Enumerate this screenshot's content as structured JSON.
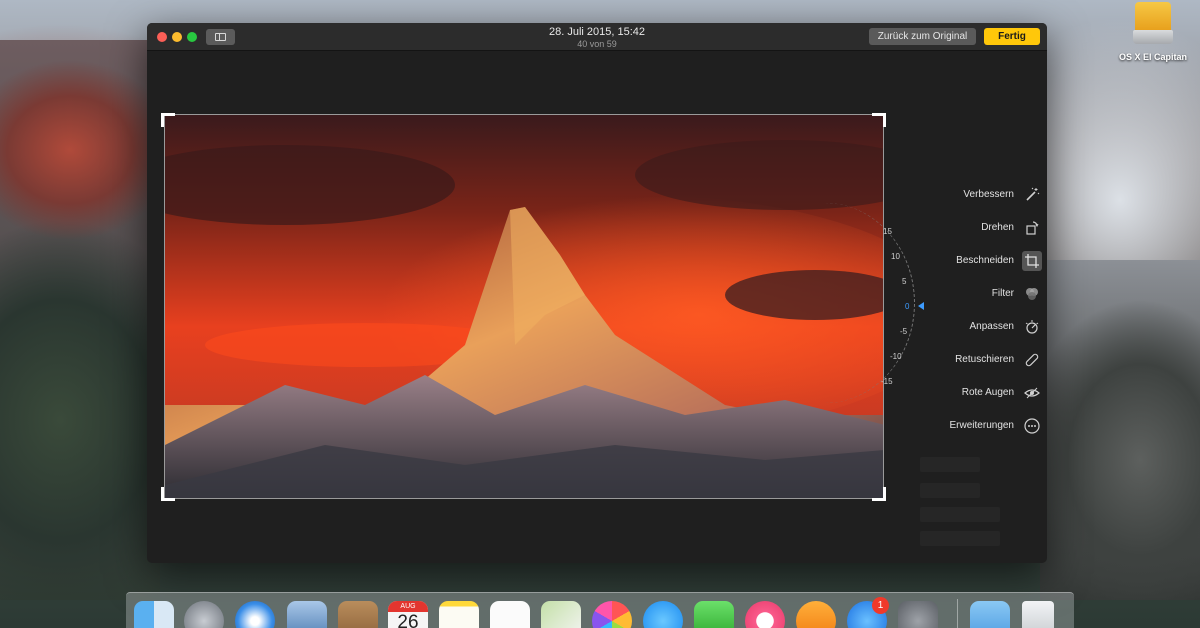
{
  "window": {
    "title_date": "28. Juli 2015, 15:42",
    "title_count": "40 von 59",
    "revert_label": "Zurück zum Original",
    "done_label": "Fertig",
    "accent_color": "#ffc70a"
  },
  "dial": {
    "labels": [
      "15",
      "10",
      "5",
      "0",
      "-5",
      "-10",
      "-15"
    ],
    "current": "0"
  },
  "tools": [
    {
      "label": "Verbessern",
      "icon": "magic-wand-icon"
    },
    {
      "label": "Drehen",
      "icon": "rotate-icon"
    },
    {
      "label": "Beschneiden",
      "icon": "crop-icon"
    },
    {
      "label": "Filter",
      "icon": "filter-circles-icon"
    },
    {
      "label": "Anpassen",
      "icon": "dial-icon"
    },
    {
      "label": "Retuschieren",
      "icon": "bandage-icon"
    },
    {
      "label": "Rote Augen",
      "icon": "eye-icon"
    },
    {
      "label": "Erweiterungen",
      "icon": "more-icon"
    }
  ],
  "desktop": {
    "drive_label": "OS X El Capitan"
  },
  "dock": {
    "calendar_month": "AUG",
    "calendar_day": "26",
    "appstore_badge": "1"
  }
}
